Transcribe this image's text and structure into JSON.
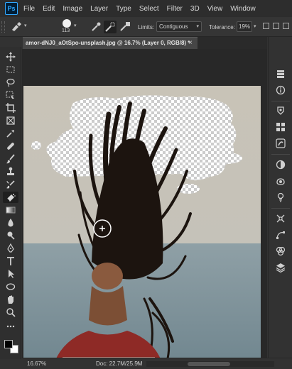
{
  "app": {
    "logo": "Ps",
    "menu": [
      "File",
      "Edit",
      "Image",
      "Layer",
      "Type",
      "Select",
      "Filter",
      "3D",
      "View",
      "Window"
    ]
  },
  "options": {
    "brush_size": "113",
    "limits_label": "Limits:",
    "limits_value": "Contiguous",
    "tolerance_label": "Tolerance:",
    "tolerance_value": "19%"
  },
  "document": {
    "tab_title": "amor-dNJ0_aOtSpo-unsplash.jpg @ 16.7% (Layer 0, RGB/8) *",
    "close_glyph": "×"
  },
  "status": {
    "zoom": "16.67%",
    "doc_size": "Doc: 22.7M/25.5M",
    "arrow": "›"
  },
  "icons": {
    "toolbar": [
      "move-icon",
      "marquee-icon",
      "lasso-icon",
      "object-select-icon",
      "crop-icon",
      "frame-icon",
      "eyedropper-icon",
      "healing-icon",
      "brush-icon",
      "clone-stamp-icon",
      "history-brush-icon",
      "eraser-icon",
      "gradient-icon",
      "blur-icon",
      "dodge-icon",
      "pen-icon",
      "type-icon",
      "path-select-icon",
      "ellipse-icon",
      "hand-icon",
      "zoom-icon"
    ],
    "panel": [
      "history-icon",
      "info-icon",
      "color-icon",
      "swatches-icon",
      "brushes-icon",
      "adjustments-icon",
      "libraries-icon",
      "patterns-icon",
      "properties-icon",
      "paths-icon",
      "channels-icon",
      "layers-icon"
    ]
  },
  "colors": {
    "accent": "#31a8ff",
    "foreground": "#000000",
    "background": "#ffffff"
  }
}
